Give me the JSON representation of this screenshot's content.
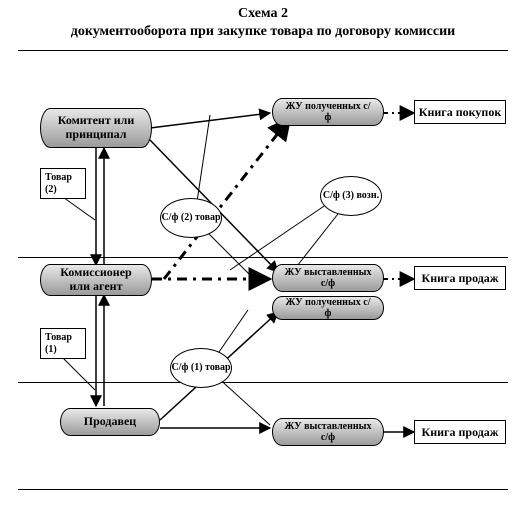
{
  "header": {
    "line1": "Схема 2",
    "line2": "документооборота при закупке товара по договору комиссии"
  },
  "nodes": {
    "komitent": "Комитент или принципал",
    "komissioner": "Комиссионер или агент",
    "prodavec": "Продавец",
    "zhu_poluch_top": "ЖУ полученных с/ф",
    "zhu_vystav_mid": "ЖУ выставленных с/ф",
    "zhu_poluch_mid": "ЖУ полученных с/ф",
    "zhu_vystav_bot": "ЖУ выставленных с/ф",
    "kniga_pokupok": "Книга покупок",
    "kniga_prodazh_mid": "Книга продаж",
    "kniga_prodazh_bot": "Книга продаж"
  },
  "labels": {
    "tovar1": "Товар (1)",
    "tovar2": "Товар (2)",
    "sf1": "С/ф (1) товар",
    "sf2": "С/ф (2) товар",
    "sf3": "С/ф (3) возн."
  }
}
